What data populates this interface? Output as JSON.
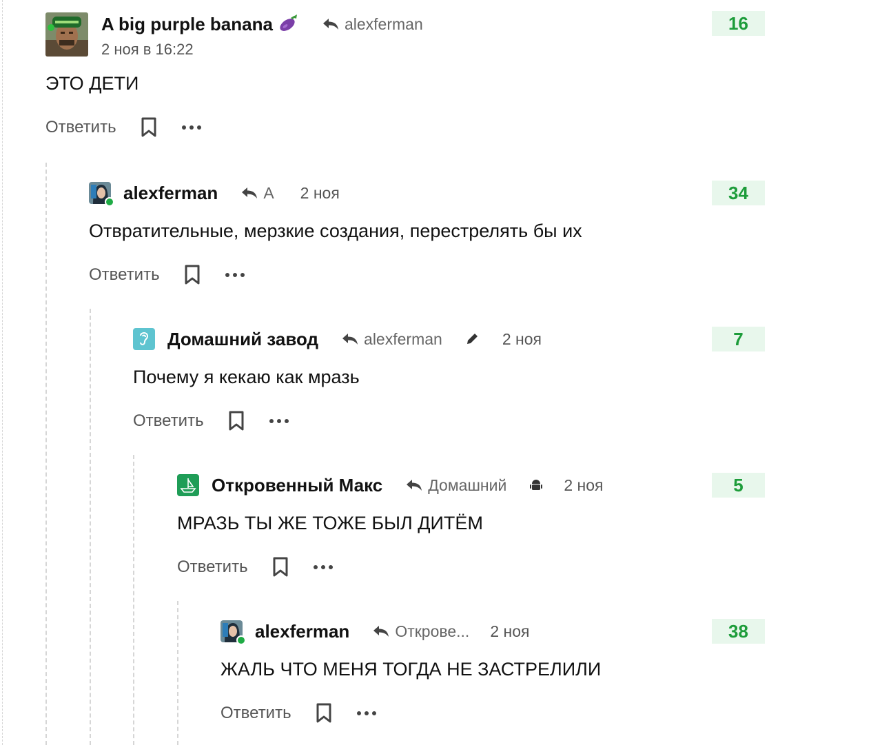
{
  "thread": {
    "reply_label": "Ответить",
    "comments": [
      {
        "author": "A big purple banana",
        "author_emoji": "eggplant",
        "reply_to": "alexferman",
        "date": "2 ноя в 16:22",
        "rating": "16",
        "text": "ЭТО ДЕТИ",
        "avatar_icon": "soldier-avatar-icon"
      },
      {
        "author": "alexferman",
        "reply_to": "A",
        "date": "2 ноя",
        "rating": "34",
        "text": "Отвратительные, мерзкие создания, перестрелять бы их",
        "online": true,
        "avatar_icon": "girl-avatar-icon"
      },
      {
        "author": "Домашний завод",
        "reply_to": "alexferman",
        "date": "2 ноя",
        "rating": "7",
        "text": "Почему я кекаю как мразь",
        "edited_icon": "pencil-icon",
        "avatar_icon": "ear-avatar-icon"
      },
      {
        "author": "Откровенный Макс",
        "reply_to": "Домашний",
        "date": "2 ноя",
        "rating": "5",
        "text": "МРАЗЬ ТЫ ЖЕ ТОЖЕ БЫЛ ДИТЁМ",
        "platform_icon": "android-icon",
        "avatar_icon": "boat-avatar-icon"
      },
      {
        "author": "alexferman",
        "reply_to": "Открове...",
        "date": "2 ноя",
        "rating": "38",
        "text": "ЖАЛЬ ЧТО МЕНЯ ТОГДА НЕ ЗАСТРЕЛИЛИ",
        "online": true,
        "avatar_icon": "girl-avatar-icon"
      }
    ]
  },
  "colors": {
    "rating_bg": "#e8f7ec",
    "rating_text": "#1d9c3a",
    "online_dot": "#1fab45",
    "thread_line": "#d6d6d6",
    "muted_text": "#555555"
  }
}
